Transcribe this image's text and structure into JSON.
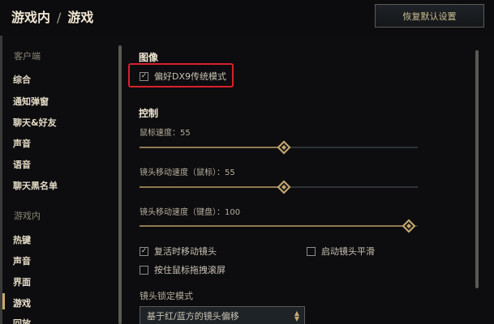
{
  "header": {
    "breadcrumb_parent": "游戏内",
    "breadcrumb_separator": "/",
    "breadcrumb_current": "游戏",
    "restore_button": "恢复默认设置"
  },
  "sidebar": {
    "client_header": "客户端",
    "client_items": [
      "综合",
      "通知弹窗",
      "聊天&好友",
      "声音",
      "语音",
      "聊天黑名单"
    ],
    "ingame_header": "游戏内",
    "ingame_items": [
      "热键",
      "声音",
      "界面",
      "游戏",
      "回放"
    ],
    "active_item": "游戏"
  },
  "graphics": {
    "title": "图像",
    "dx9_label": "偏好DX9传统模式",
    "dx9_checked": true
  },
  "controls": {
    "title": "控制",
    "mouse_speed_label": "鼠标速度：55",
    "mouse_speed_value": 55,
    "camera_mouse_label": "镜头移动速度（鼠标）：55",
    "camera_mouse_value": 55,
    "camera_keyboard_label": "镜头移动速度（键盘）：100",
    "camera_keyboard_value": 100,
    "respawn_camera_label": "复活时移动镜头",
    "respawn_camera_checked": true,
    "smooth_camera_label": "启动镜头平滑",
    "smooth_camera_checked": false,
    "drag_scroll_label": "按住鼠标拖拽滚屏",
    "drag_scroll_checked": false,
    "camera_lock_title": "镜头锁定模式",
    "camera_lock_value": "基于红/蓝方的镜头偏移"
  },
  "icons": {
    "checkbox_checked": "check-icon",
    "dropdown": "up-down-arrows-icon",
    "slider_thumb": "diamond-thumb-icon"
  },
  "colors": {
    "accent": "#c8aa6e",
    "highlight": "#d8202a",
    "background": "#0d0d10"
  }
}
